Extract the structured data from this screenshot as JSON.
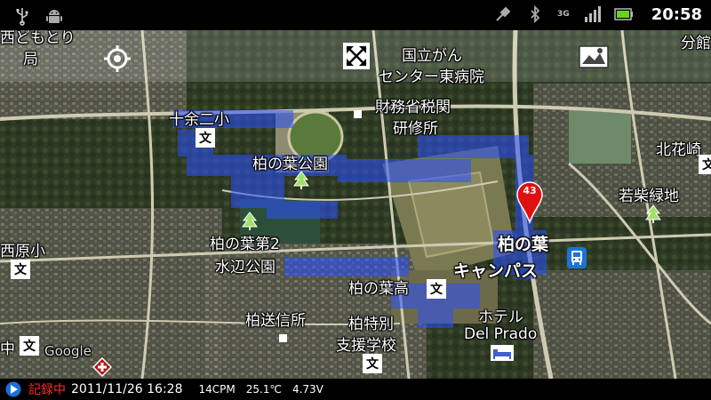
{
  "statusbar": {
    "time": "20:58",
    "network": "3G",
    "icons": [
      "usb-icon",
      "android-icon",
      "tool-icon",
      "bluetooth-icon",
      "signal-icon",
      "battery-icon"
    ]
  },
  "map": {
    "labels": {
      "top_left_clip": "西どもとり",
      "top_left2": "局",
      "cancer_center_1": "国立がん",
      "cancer_center_2": "センター東病院",
      "tax_1": "財務省税関",
      "tax_2": "研修所",
      "top_right": "分館",
      "juyonishi": "十余二小",
      "kashiwanoha_park": "柏の葉公園",
      "kitakashiwa": "北花崎",
      "wakashiba": "若柴緑地",
      "nishihara": "西原小",
      "kashiwanoha2": "柏の葉第2",
      "mizube": "水辺公園",
      "campus_1": "柏の葉",
      "campus_2": "キャンパス",
      "kashiwanoha_high": "柏の葉高",
      "hotel_1": "ホテル",
      "hotel_2": "Del Prado",
      "sosin": "柏送信所",
      "special_1": "柏特別",
      "special_2": "支援学校",
      "naka": "中",
      "google": "Google"
    },
    "school_symbol": "文",
    "marker_number": "43",
    "bus_symbol": "🚌"
  },
  "recording": {
    "status": "記録中",
    "datetime": "2011/11/26 16:28",
    "cpm": "14CPM",
    "temperature": "25.1℃",
    "voltage": "4.73V"
  },
  "colors": {
    "track_blue": "#2a50ff",
    "marker_red": "#e01010",
    "rec_red": "#ff2a2a"
  }
}
